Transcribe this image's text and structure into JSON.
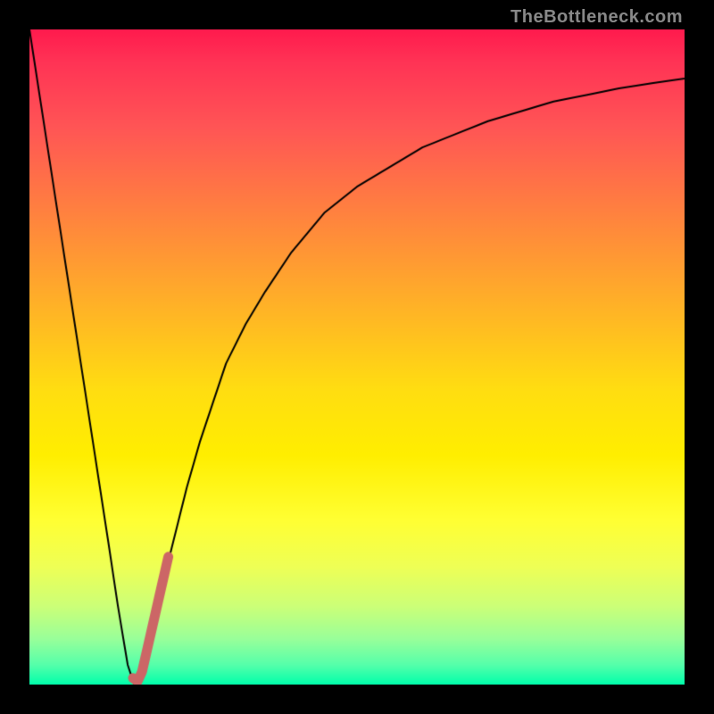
{
  "attribution": "TheBottleneck.com",
  "chart_data": {
    "type": "line",
    "title": "",
    "xlabel": "",
    "ylabel": "",
    "xlim": [
      0,
      100
    ],
    "ylim": [
      0,
      100
    ],
    "series": [
      {
        "name": "bottleneck-curve",
        "x": [
          0,
          2,
          4,
          6,
          8,
          10,
          12,
          13.5,
          15,
          16,
          17,
          18,
          20,
          22,
          24,
          26,
          28,
          30,
          33,
          36,
          40,
          45,
          50,
          55,
          60,
          65,
          70,
          75,
          80,
          85,
          90,
          95,
          100
        ],
        "values": [
          100,
          87,
          74,
          61,
          48,
          35,
          22,
          12,
          3,
          0,
          2,
          6,
          14,
          22,
          30,
          37,
          43,
          49,
          55,
          60,
          66,
          72,
          76,
          79,
          82,
          84,
          86,
          87.5,
          89,
          90,
          91,
          91.8,
          92.5
        ],
        "stroke": "#000000",
        "stroke_width": 2
      },
      {
        "name": "highlight-segment",
        "x": [
          15.8,
          16.5,
          17.2,
          18,
          18.8,
          19.6,
          20.4,
          21.2
        ],
        "values": [
          1,
          0.5,
          2,
          5.5,
          9,
          12.5,
          16,
          19.5
        ],
        "stroke": "#cc6666",
        "stroke_width": 11,
        "linecap": "round"
      }
    ],
    "colors": {
      "background_frame": "#000000",
      "gradient_top": "#ff1a4d",
      "gradient_bottom": "#00ffaa",
      "curve": "#000000",
      "highlight": "#cc6666",
      "attribution": "#888888"
    }
  }
}
